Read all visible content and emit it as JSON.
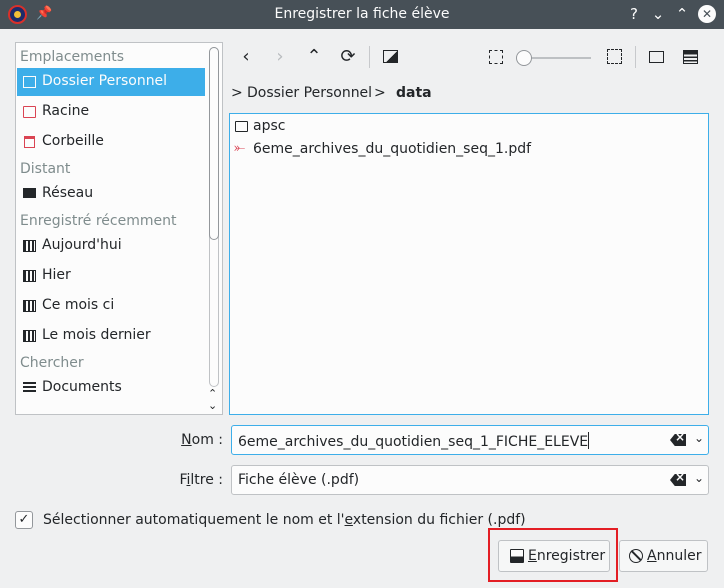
{
  "window": {
    "title": "Enregistrer la fiche élève",
    "help_glyph": "?",
    "minimize_glyph": "⌄",
    "maximize_glyph": "⌃",
    "close_glyph": "✕"
  },
  "places": {
    "sections": [
      {
        "label": "Emplacements"
      },
      {
        "label": "Distant"
      },
      {
        "label": "Enregistré récemment"
      },
      {
        "label": "Chercher"
      }
    ],
    "items": [
      {
        "label": "Dossier Personnel",
        "icon": "home-folder-icon",
        "selected": true
      },
      {
        "label": "Racine",
        "icon": "root-folder-icon"
      },
      {
        "label": "Corbeille",
        "icon": "trash-icon"
      },
      {
        "label": "Réseau",
        "icon": "network-icon"
      },
      {
        "label": "Aujourd'hui",
        "icon": "calendar-icon"
      },
      {
        "label": "Hier",
        "icon": "calendar-icon"
      },
      {
        "label": "Ce mois ci",
        "icon": "calendar-icon"
      },
      {
        "label": "Le mois dernier",
        "icon": "calendar-icon"
      },
      {
        "label": "Documents",
        "icon": "document-icon"
      }
    ]
  },
  "toolbar": {
    "back": "‹",
    "forward": "›",
    "up": "⌃",
    "reload": "⟳"
  },
  "breadcrumb": {
    "parent": "Dossier Personnel",
    "current": "data",
    "separator": ">"
  },
  "files": [
    {
      "name": "apsc",
      "type": "folder",
      "icon": "folder-icon"
    },
    {
      "name": "6eme_archives_du_quotidien_seq_1.pdf",
      "type": "pdf",
      "icon": "pdf-icon"
    }
  ],
  "name_field": {
    "label_underlined": "N",
    "label_rest": "om :",
    "value": "6eme_archives_du_quotidien_seq_1_FICHE_ELEVE"
  },
  "filter_field": {
    "label_pre": "F",
    "label_underlined": "i",
    "label_rest": "ltre :",
    "value": "Fiche élève (.pdf)"
  },
  "auto_extension": {
    "checked": true,
    "label_pre": "Sélectionner automatiquement le nom et l'",
    "label_underlined": "e",
    "label_post": "xtension du fichier (.pdf)"
  },
  "buttons": {
    "save_underlined": "E",
    "save_rest": "nregistrer",
    "cancel_underlined": "A",
    "cancel_rest": "nnuler"
  },
  "colors": {
    "accent": "#3daee9",
    "titlebar": "#475057",
    "highlight_border": "#e31e24"
  }
}
